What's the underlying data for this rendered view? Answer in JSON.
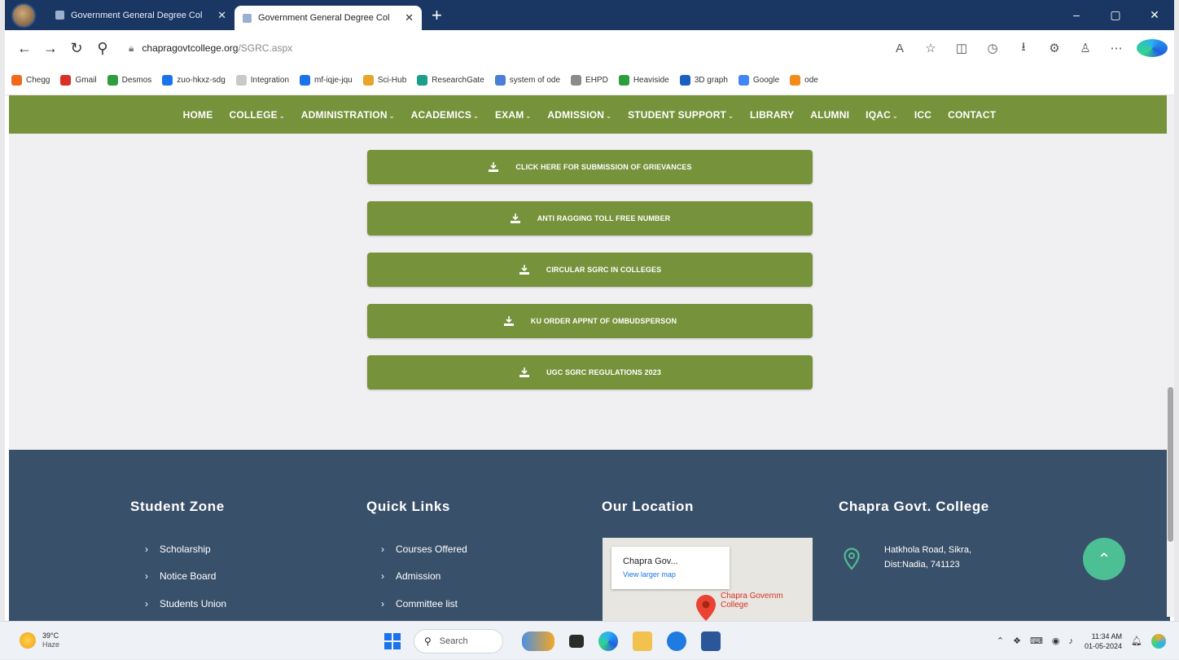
{
  "browser": {
    "tabs": [
      {
        "title": "Government General Degree Col",
        "active": false
      },
      {
        "title": "Government General Degree Col",
        "active": true
      }
    ],
    "new_tab": "+",
    "window_controls": [
      "–",
      "▢",
      "✕"
    ],
    "url_host": "chapragovtcollege.org",
    "url_path": "/SGRC.aspx",
    "bookmarks": [
      {
        "label": "Chegg",
        "color": "#f06a1b"
      },
      {
        "label": "Gmail",
        "color": "#d93025"
      },
      {
        "label": "Desmos",
        "color": "#2e9d3e"
      },
      {
        "label": "zuo-hkxz-sdg",
        "color": "#1a73e8"
      },
      {
        "label": "Integration",
        "color": "#c9c9c9"
      },
      {
        "label": "mf-iqje-jqu",
        "color": "#1a73e8"
      },
      {
        "label": "Sci-Hub",
        "color": "#e8a52a"
      },
      {
        "label": "ResearchGate",
        "color": "#1b9e8a"
      },
      {
        "label": "system of ode",
        "color": "#4a7fd6"
      },
      {
        "label": "EHPD",
        "color": "#8a8a8a"
      },
      {
        "label": "Heaviside",
        "color": "#2e9d3e"
      },
      {
        "label": "3D graph",
        "color": "#1a5fc2"
      },
      {
        "label": "Google",
        "color": "#4285f4"
      },
      {
        "label": "ode",
        "color": "#f28b1b"
      }
    ]
  },
  "site": {
    "accent": "#76923b",
    "footer_bg": "#39506a",
    "nav": [
      {
        "label": "HOME",
        "dropdown": false
      },
      {
        "label": "COLLEGE",
        "dropdown": true
      },
      {
        "label": "ADMINISTRATION",
        "dropdown": true
      },
      {
        "label": "ACADEMICS",
        "dropdown": true
      },
      {
        "label": "EXAM",
        "dropdown": true
      },
      {
        "label": "ADMISSION",
        "dropdown": true
      },
      {
        "label": "STUDENT SUPPORT",
        "dropdown": true
      },
      {
        "label": "LIBRARY",
        "dropdown": false
      },
      {
        "label": "ALUMNI",
        "dropdown": false
      },
      {
        "label": "IQAC",
        "dropdown": true
      },
      {
        "label": "ICC",
        "dropdown": false
      },
      {
        "label": "CONTACT",
        "dropdown": false
      }
    ],
    "download_buttons": [
      "CLICK HERE FOR SUBMISSION OF GRIEVANCES",
      "ANTI RAGGING TOLL FREE NUMBER",
      "CIRCULAR SGRC IN COLLEGES",
      "KU ORDER APPNT OF OMBUDSPERSON",
      "UGC SGRC REGULATIONS 2023"
    ],
    "footer": {
      "student_zone": {
        "title": "Student Zone",
        "links": [
          "Scholarship",
          "Notice Board",
          "Students Union"
        ]
      },
      "quick_links": {
        "title": "Quick Links",
        "links": [
          "Courses Offered",
          "Admission",
          "Committee list"
        ]
      },
      "location": {
        "title": "Our Location",
        "map_title": "Chapra Gov...",
        "map_link": "View larger map",
        "map_label_1": "Chapra Governm",
        "map_label_2": "College"
      },
      "college": {
        "title": "Chapra Govt. College",
        "address_1": "Hatkhola Road, Sikra,",
        "address_2": "Dist:Nadia, 741123"
      }
    },
    "scroll_top": "⌃"
  },
  "taskbar": {
    "temp": "39°C",
    "weather": "Haze",
    "search_placeholder": "Search",
    "time": "11:34 AM",
    "date": "01-05-2024"
  }
}
